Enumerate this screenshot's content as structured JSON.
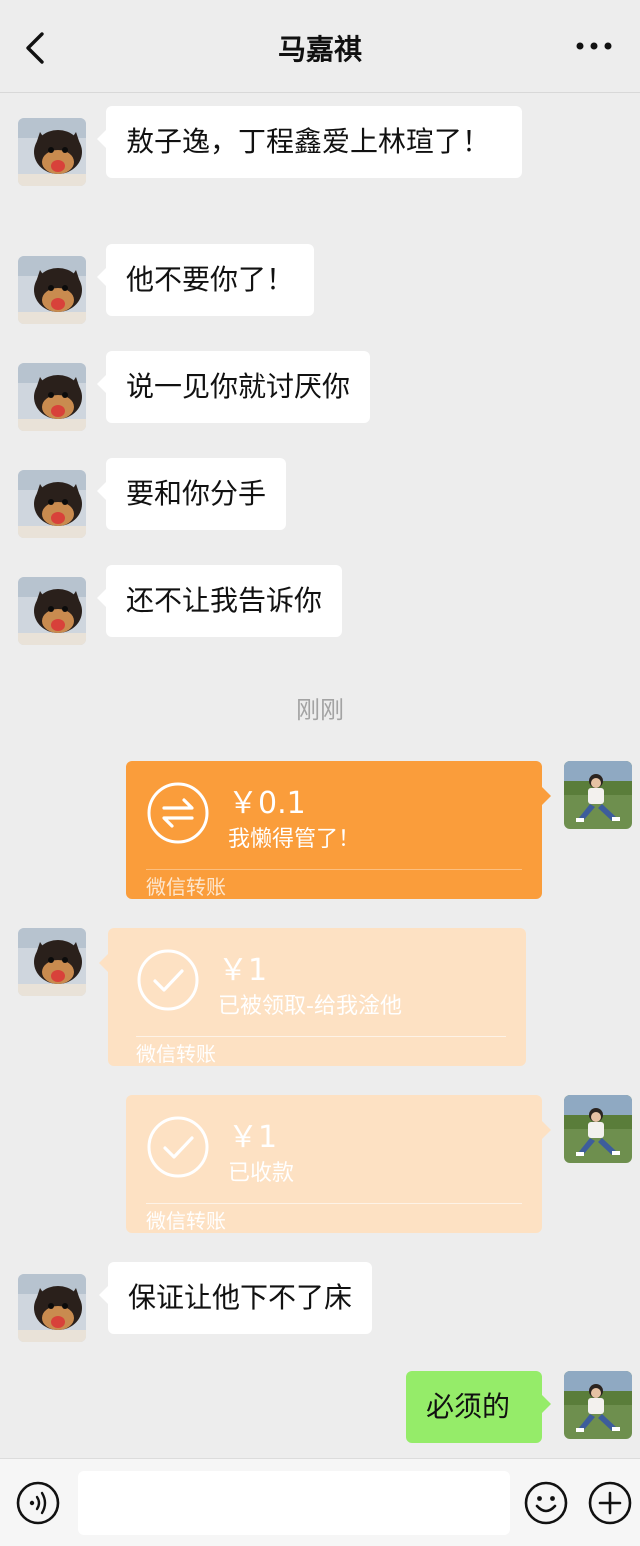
{
  "header": {
    "title": "马嘉祺",
    "back_icon": "chevron-left-icon",
    "more_icon": "more-horizontal-icon"
  },
  "messages": [
    {
      "from": "them",
      "text": "敖子逸，丁程鑫爱上林瑄了！"
    },
    {
      "from": "them",
      "text": "他不要你了！"
    },
    {
      "from": "them",
      "text": "说一见你就讨厌你"
    },
    {
      "from": "them",
      "text": "要和你分手"
    },
    {
      "from": "them",
      "text": "还不让我告诉你"
    }
  ],
  "timestamp": "刚刚",
  "transfers": [
    {
      "from": "me",
      "status": "active",
      "amount": "￥0.1",
      "note": "我懒得管了！",
      "label": "微信转账",
      "icon": "transfer-arrows-icon"
    },
    {
      "from": "them",
      "status": "received",
      "amount": "￥1",
      "note": "已被领取-给我淦他",
      "label": "微信转账",
      "icon": "checkmark-circle-icon"
    },
    {
      "from": "me",
      "status": "received",
      "amount": "￥1",
      "note": "已收款",
      "label": "微信转账",
      "icon": "checkmark-circle-icon"
    }
  ],
  "messages_after": [
    {
      "from": "them",
      "text": "保证让他下不了床"
    },
    {
      "from": "me",
      "text": "必须的"
    }
  ],
  "input_bar": {
    "voice_icon": "voice-icon",
    "emoji_icon": "emoji-icon",
    "plus_icon": "plus-circle-icon",
    "placeholder": ""
  },
  "colors": {
    "background": "#ededed",
    "bubble_them": "#ffffff",
    "bubble_me": "#95ec69",
    "transfer_active": "#fa9d3b",
    "transfer_done": "#fde1c3"
  }
}
